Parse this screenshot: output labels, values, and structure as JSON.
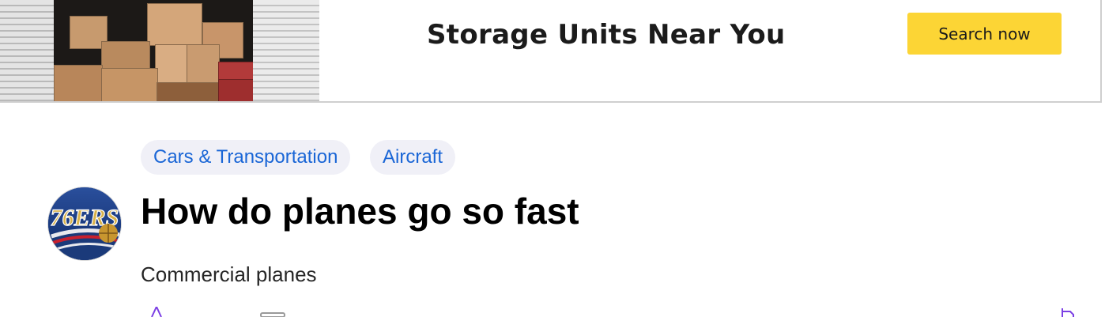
{
  "ad": {
    "headline": "Storage Units Near You",
    "cta_label": "Search now",
    "cta_color": "#fcd535"
  },
  "categories": [
    {
      "label": "Cars & Transportation"
    },
    {
      "label": "Aircraft"
    }
  ],
  "question": {
    "title": "How do planes go so fast",
    "body": "Commercial planes"
  },
  "avatar": {
    "icon": "team-logo-avatar"
  },
  "colors": {
    "link_blue": "#1a66d6",
    "chip_bg": "#f0f0f7",
    "accent_purple": "#7b3fe4"
  }
}
